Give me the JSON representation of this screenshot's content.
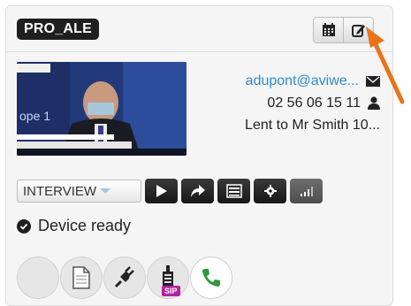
{
  "card": {
    "name_badge": "PRO_ALE",
    "top_buttons": [
      {
        "icon": "calendar-icon"
      },
      {
        "icon": "edit-icon"
      }
    ]
  },
  "thumbnail": {
    "channel_text": "ope 1",
    "alt": "video-thumbnail"
  },
  "info": {
    "email": "adupont@aviwe...",
    "email_icon": "envelope-icon",
    "phone": "02 56 06 15 11",
    "phone_icon": "user-icon",
    "note": "Lent to Mr Smith 10..."
  },
  "controls": {
    "mode_value": "INTERVIEW",
    "buttons": [
      {
        "icon": "play-icon"
      },
      {
        "icon": "share-icon"
      },
      {
        "icon": "list-icon"
      },
      {
        "icon": "gear-icon"
      },
      {
        "icon": "signal-bars-icon"
      }
    ]
  },
  "status": {
    "text": "Device ready",
    "icon": "check-circle-icon"
  },
  "connectors": [
    {
      "icon": "empty-circle"
    },
    {
      "icon": "document-icon"
    },
    {
      "icon": "plug-icon"
    },
    {
      "icon": "sip-device-icon",
      "badge": "SIP"
    },
    {
      "icon": "phone-icon"
    }
  ],
  "colors": {
    "email": "#2e8bcb",
    "annotation_arrow": "#e8741a",
    "sip_badge": "#b5219f",
    "phone_green": "#2d9a3c"
  }
}
